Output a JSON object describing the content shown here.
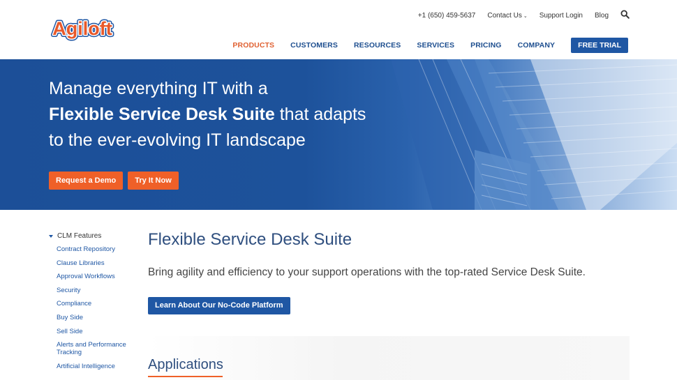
{
  "header": {
    "logo_text": "Agiloft",
    "utility": {
      "phone": "+1 (650) 459-5637",
      "contact": "Contact Us",
      "support": "Support Login",
      "blog": "Blog"
    },
    "nav": [
      {
        "label": "PRODUCTS",
        "active": true
      },
      {
        "label": "CUSTOMERS"
      },
      {
        "label": "RESOURCES"
      },
      {
        "label": "SERVICES"
      },
      {
        "label": "PRICING"
      },
      {
        "label": "COMPANY"
      }
    ],
    "cta": "FREE TRIAL"
  },
  "hero": {
    "line1": "Manage everything IT with a",
    "line2_bold": "Flexible Service Desk Suite",
    "line2_rest": " that adapts",
    "line3": "to the ever-evolving IT landscape",
    "buttons": [
      "Request a Demo",
      "Try It Now"
    ]
  },
  "sidebar": {
    "heading": "CLM Features",
    "items": [
      "Contract Repository",
      "Clause Libraries",
      "Approval Workflows",
      "Security",
      "Compliance",
      "Buy Side",
      "Sell Side",
      "Alerts and Performance Tracking",
      "Artificial Intelligence"
    ]
  },
  "main": {
    "title": "Flexible Service Desk Suite",
    "subtitle": "Bring agility and efficiency to your support operations with the top-rated Service Desk Suite.",
    "button": "Learn About Our No-Code Platform",
    "section_title": "Applications"
  },
  "colors": {
    "brand_blue": "#1f57a4",
    "accent_orange": "#ef6028",
    "hero_blue": "#1c4f98"
  },
  "icons": {
    "search": "search-icon",
    "chevron": "chevron-down-icon",
    "sidebar_toggle": "triangle-down-icon"
  }
}
